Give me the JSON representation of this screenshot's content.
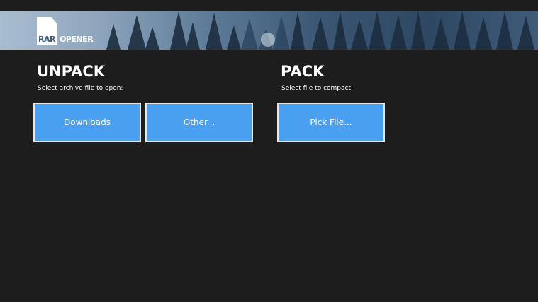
{
  "app": {
    "logo_left": "RAR",
    "logo_right": "OPENER"
  },
  "unpack": {
    "title": "UNPACK",
    "subtitle": "Select archive file to open:",
    "buttons": [
      "Downloads",
      "Other..."
    ]
  },
  "pack": {
    "title": "PACK",
    "subtitle": "Select file to compact:",
    "buttons": [
      "Pick File..."
    ]
  },
  "colors": {
    "background": "#1d1d1d",
    "tile": "#4aa0f0",
    "tile_border": "#e8e8e8"
  }
}
